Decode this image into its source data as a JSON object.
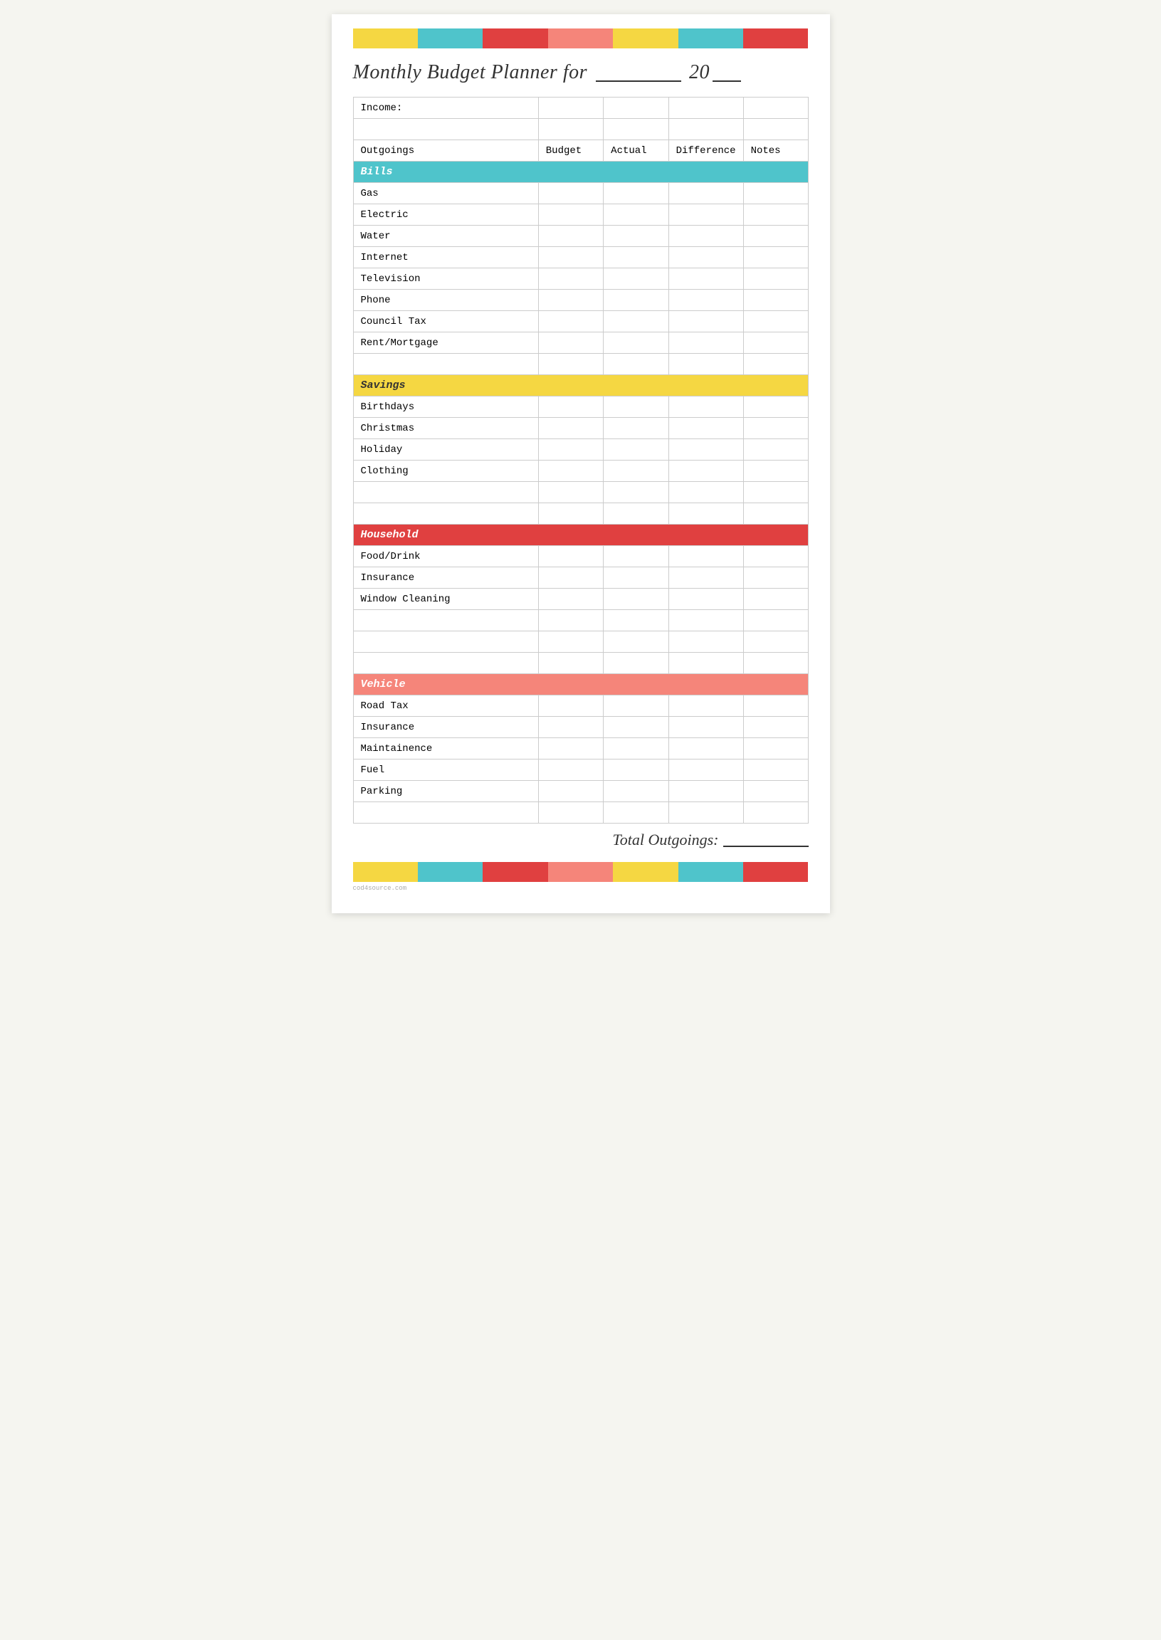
{
  "page": {
    "title": "Monthly Budget Planner for",
    "year_prefix": "20",
    "color_swatches_top": [
      {
        "color": "#f5d742",
        "name": "yellow"
      },
      {
        "color": "#4fc4cb",
        "name": "teal"
      },
      {
        "color": "#e04040",
        "name": "red"
      },
      {
        "color": "#f5857a",
        "name": "pink"
      },
      {
        "color": "#f5d742",
        "name": "yellow2"
      },
      {
        "color": "#4fc4cb",
        "name": "teal2"
      },
      {
        "color": "#e04040",
        "name": "red2"
      }
    ],
    "color_swatches_bottom": [
      {
        "color": "#f5d742",
        "name": "yellow"
      },
      {
        "color": "#4fc4cb",
        "name": "teal"
      },
      {
        "color": "#e04040",
        "name": "red"
      },
      {
        "color": "#f5857a",
        "name": "pink"
      },
      {
        "color": "#f5d742",
        "name": "yellow2"
      },
      {
        "color": "#4fc4cb",
        "name": "teal2"
      },
      {
        "color": "#e04040",
        "name": "red2"
      }
    ],
    "table": {
      "income_label": "Income:",
      "columns": {
        "outgoings": "Outgoings",
        "budget": "Budget",
        "actual": "Actual",
        "difference": "Difference",
        "notes": "Notes"
      },
      "sections": [
        {
          "name": "Bills",
          "color_class": "cat-bills",
          "items": [
            "Gas",
            "Electric",
            "Water",
            "Internet",
            "Television",
            "Phone",
            "Council Tax",
            "Rent/Mortgage",
            ""
          ]
        },
        {
          "name": "Savings",
          "color_class": "cat-savings",
          "items": [
            "Birthdays",
            "Christmas",
            "Holiday",
            "Clothing",
            "",
            ""
          ]
        },
        {
          "name": "Household",
          "color_class": "cat-household",
          "items": [
            "Food/Drink",
            "Insurance",
            "Window Cleaning",
            "",
            "",
            ""
          ]
        },
        {
          "name": "Vehicle",
          "color_class": "cat-vehicle",
          "items": [
            "Road Tax",
            "Insurance",
            "Maintainence",
            "Fuel",
            "Parking",
            ""
          ]
        }
      ]
    },
    "total_label": "Total Outgoings:",
    "watermark": "cod4source.com"
  }
}
